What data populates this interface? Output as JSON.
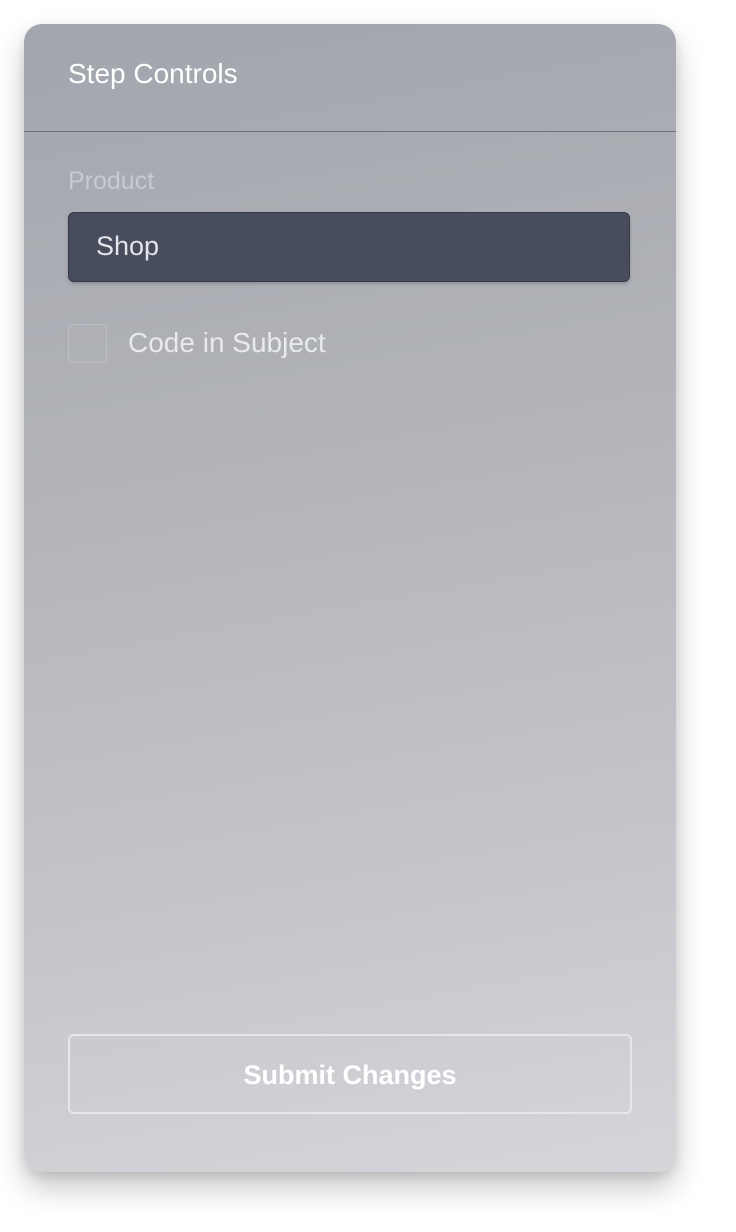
{
  "panel": {
    "title": "Step Controls"
  },
  "product_field": {
    "label": "Product",
    "value": "Shop"
  },
  "code_in_subject": {
    "label": "Code in Subject",
    "checked": false
  },
  "actions": {
    "submit_label": "Submit Changes"
  },
  "colors": {
    "select_background": "#474d5d",
    "panel_top": "#a2a5ad",
    "panel_bottom": "#d5d5da"
  }
}
